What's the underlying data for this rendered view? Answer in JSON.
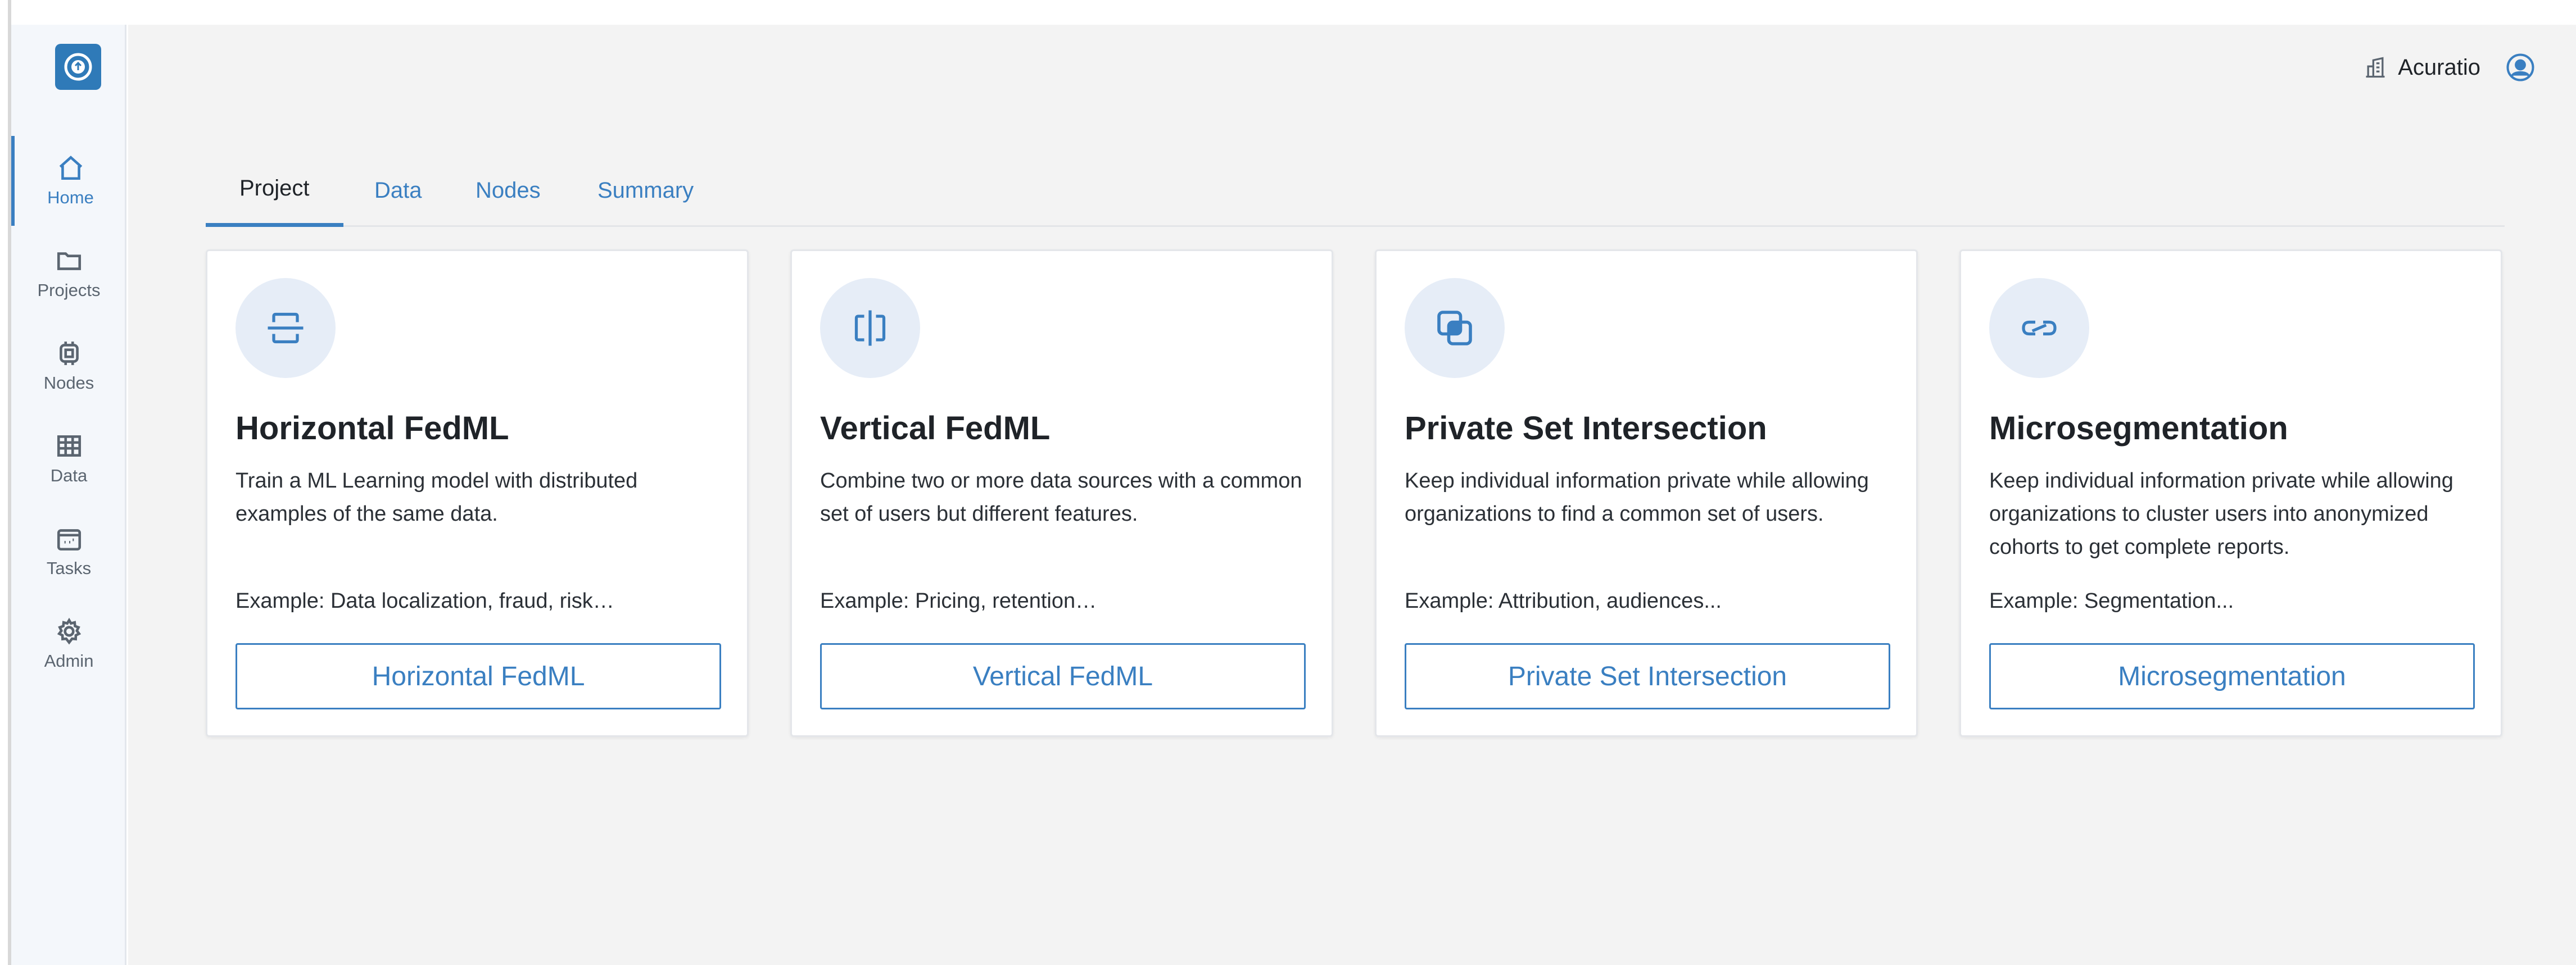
{
  "brand": {
    "accent": "#3a7fc1",
    "icon_bg": "#e6edf7"
  },
  "sidebar": {
    "items": [
      {
        "label": "Home",
        "icon": "home-icon",
        "active": true
      },
      {
        "label": "Projects",
        "icon": "folder-icon",
        "active": false
      },
      {
        "label": "Nodes",
        "icon": "chip-icon",
        "active": false
      },
      {
        "label": "Data",
        "icon": "table-icon",
        "active": false
      },
      {
        "label": "Tasks",
        "icon": "calendar-icon",
        "active": false
      },
      {
        "label": "Admin",
        "icon": "gear-icon",
        "active": false
      }
    ]
  },
  "header": {
    "org_name": "Acuratio",
    "org_icon": "building-icon",
    "user_icon": "user-avatar-icon"
  },
  "tabs": [
    {
      "label": "Project",
      "active": true
    },
    {
      "label": "Data",
      "active": false
    },
    {
      "label": "Nodes",
      "active": false
    },
    {
      "label": "Summary",
      "active": false
    }
  ],
  "cards": [
    {
      "icon": "horizontal-split-icon",
      "title": "Horizontal FedML",
      "description": "Train a ML Learning model with distributed examples of the same data.",
      "example": "Example: Data localization, fraud, risk…",
      "button": "Horizontal FedML"
    },
    {
      "icon": "vertical-split-icon",
      "title": "Vertical FedML",
      "description": "Combine two or more data sources with a common set of users but different features.",
      "example": "Example: Pricing, retention…",
      "button": "Vertical FedML"
    },
    {
      "icon": "intersection-icon",
      "title": "Private Set Intersection",
      "description": "Keep individual information private while allowing organizations to find a common set of users.",
      "example": "Example: Attribution, audiences...",
      "button": "Private Set Intersection"
    },
    {
      "icon": "link-icon",
      "title": "Microsegmentation",
      "description": "Keep individual information private while allowing organizations to cluster users into anonymized cohorts to get complete reports.",
      "example": "Example: Segmentation...",
      "button": "Microsegmentation"
    }
  ]
}
